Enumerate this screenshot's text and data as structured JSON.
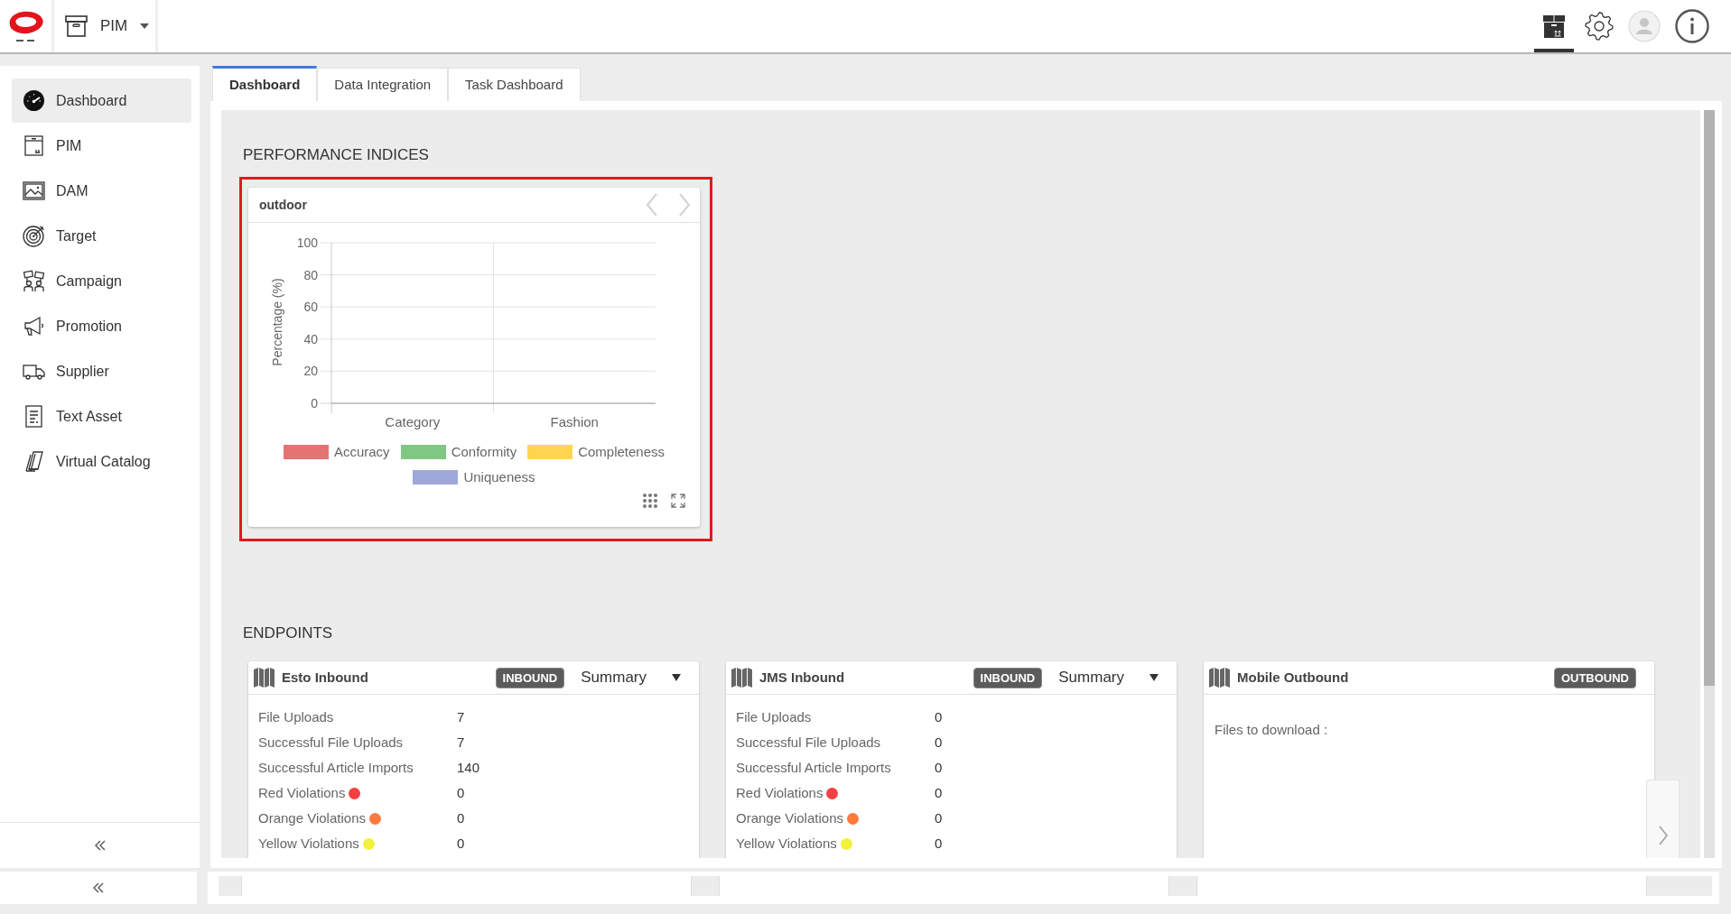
{
  "header": {
    "module": {
      "label": "PIM"
    },
    "toolbar": [
      {
        "selected": true
      },
      {
        "selected": false
      },
      {
        "selected": false
      },
      {
        "selected": false
      }
    ]
  },
  "sidebar": {
    "items": [
      {
        "label": "Dashboard",
        "selected": true
      },
      {
        "label": "PIM",
        "selected": false
      },
      {
        "label": "DAM",
        "selected": false
      },
      {
        "label": "Target",
        "selected": false
      },
      {
        "label": "Campaign",
        "selected": false
      },
      {
        "label": "Promotion",
        "selected": false
      },
      {
        "label": "Supplier",
        "selected": false
      },
      {
        "label": "Text Asset",
        "selected": false
      },
      {
        "label": "Virtual Catalog",
        "selected": false
      }
    ]
  },
  "tabs": [
    {
      "label": "Dashboard",
      "selected": true
    },
    {
      "label": "Data Integration",
      "selected": false
    },
    {
      "label": "Task Dashboard",
      "selected": false
    }
  ],
  "performance": {
    "title": "PERFORMANCE INDICES",
    "highlighted": true,
    "widget": {
      "title": "outdoor",
      "chart_data": {
        "type": "bar",
        "ylabel": "Percentage (%)",
        "categories": [
          "Category",
          "Fashion"
        ],
        "series": [
          {
            "name": "Accuracy",
            "color": "#e57373",
            "values": [
              null,
              null
            ]
          },
          {
            "name": "Conformity",
            "color": "#81c784",
            "values": [
              null,
              null
            ]
          },
          {
            "name": "Completeness",
            "color": "#ffd54f",
            "values": [
              null,
              null
            ]
          },
          {
            "name": "Uniqueness",
            "color": "#9fa8da",
            "values": [
              null,
              null
            ]
          }
        ],
        "ylim": [
          0,
          100
        ],
        "yticks": [
          0,
          20,
          40,
          60,
          80,
          100
        ],
        "grid": true
      }
    }
  },
  "endpoints": {
    "title": "ENDPOINTS",
    "cards": [
      {
        "name": "Esto Inbound",
        "badge": "INBOUND",
        "view": "Summary",
        "stats": [
          {
            "label": "File Uploads",
            "value": "7"
          },
          {
            "label": "Successful File Uploads",
            "value": "7"
          },
          {
            "label": "Successful Article Imports",
            "value": "140"
          },
          {
            "label": "Red Violations",
            "value": "0",
            "color": "#f44040"
          },
          {
            "label": "Orange Violations",
            "value": "0",
            "color": "#ff7a3d"
          },
          {
            "label": "Yellow Violations",
            "value": "0",
            "color": "#f2f23a"
          }
        ]
      },
      {
        "name": "JMS Inbound",
        "badge": "INBOUND",
        "view": "Summary",
        "stats": [
          {
            "label": "File Uploads",
            "value": "0"
          },
          {
            "label": "Successful File Uploads",
            "value": "0"
          },
          {
            "label": "Successful Article Imports",
            "value": "0"
          },
          {
            "label": "Red Violations",
            "value": "0",
            "color": "#f44040"
          },
          {
            "label": "Orange Violations",
            "value": "0",
            "color": "#ff7a3d"
          },
          {
            "label": "Yellow Violations",
            "value": "0",
            "color": "#f2f23a"
          }
        ]
      },
      {
        "name": "Mobile Outbound",
        "badge": "OUTBOUND",
        "note": "Files to download :"
      }
    ]
  }
}
